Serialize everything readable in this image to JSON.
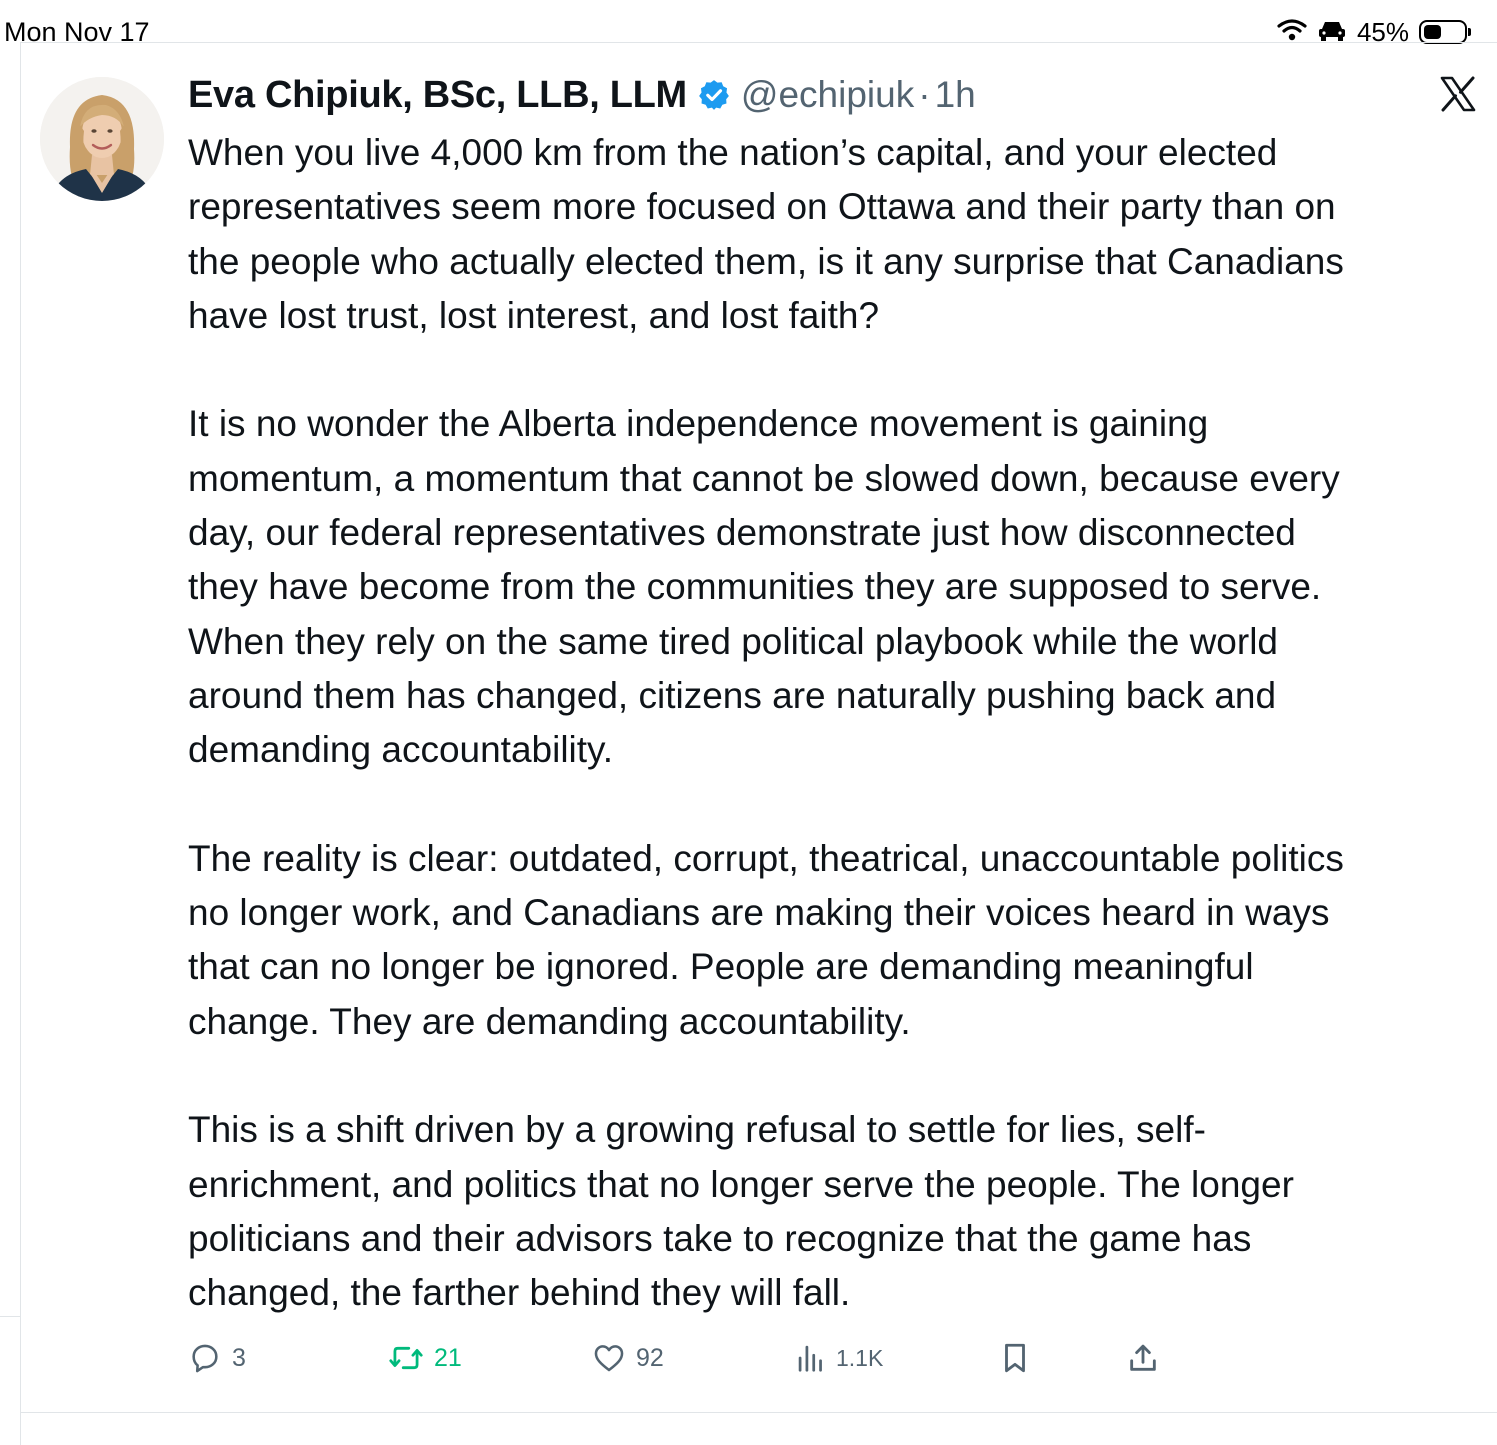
{
  "status_bar": {
    "time": "Mon Nov 17",
    "battery_percent": "45%",
    "battery_level": 0.45,
    "icons": [
      "wifi-icon",
      "car-icon",
      "battery-icon"
    ]
  },
  "tweet": {
    "author": {
      "display_name": "Eva Chipiuk, BSc, LLB, LLM",
      "handle": "@echipiuk",
      "verified": true
    },
    "separator": "·",
    "timestamp": "1h",
    "paragraphs": [
      "When you live 4,000 km from the nation’s capital, and your elected representatives seem more focused on Ottawa and their party than on the people who actually elected them, is it any surprise that Canadians have lost trust, lost interest, and lost faith?",
      "It is no wonder the Alberta independence movement is gaining momentum, a momentum that cannot be slowed down, because every day, our federal representatives demonstrate just how disconnected they have become from the communities they are supposed to serve. When they rely on the same tired political playbook while the world around them has changed, citizens are naturally pushing back and demanding accountability.",
      "The reality is clear: outdated, corrupt, theatrical, unaccountable politics no longer work, and Canadians are making their voices heard in ways that can no longer be ignored. People are demanding meaningful change. They are demanding accountability.",
      "This is a shift driven by a growing refusal to settle for lies, self-enrichment, and politics that no longer serve the people. The longer politicians and their advisors take to recognize that the game has changed, the farther behind they will fall."
    ],
    "paragraph_lines": [
      "When you live 4,000 km from the nation’s capital, and your elected\nrepresentatives seem more focused on Ottawa and their party than on\nthe people who actually elected them, is it any surprise that Canadians\nhave lost trust, lost interest, and lost faith?",
      "It is no wonder the Alberta independence movement is gaining\nmomentum, a momentum that cannot be slowed down, because every\nday, our federal representatives demonstrate just how disconnected\nthey have become from the communities they are supposed to serve.\nWhen they rely on the same tired political playbook while the world\naround them has changed, citizens are naturally pushing back and\ndemanding accountability.",
      "The reality is clear: outdated, corrupt, theatrical, unaccountable politics\nno longer work, and Canadians are making their voices heard in ways\nthat can no longer be ignored. People are demanding meaningful\nchange. They are demanding accountability.",
      "This is a shift driven by a growing refusal to settle for lies, self-\nenrichment, and politics that no longer serve the people. The longer\npoliticians and their advisors take to recognize that the game has\nchanged, the farther behind they will fall."
    ],
    "actions": {
      "replies": "3",
      "retweets": "21",
      "likes": "92",
      "views": "1.1K"
    }
  },
  "colors": {
    "text_primary": "#0f1419",
    "text_secondary": "#536471",
    "verified_blue": "#1d9bf0",
    "retweet_green": "#00ba7c",
    "divider": "#e1e5e8"
  }
}
